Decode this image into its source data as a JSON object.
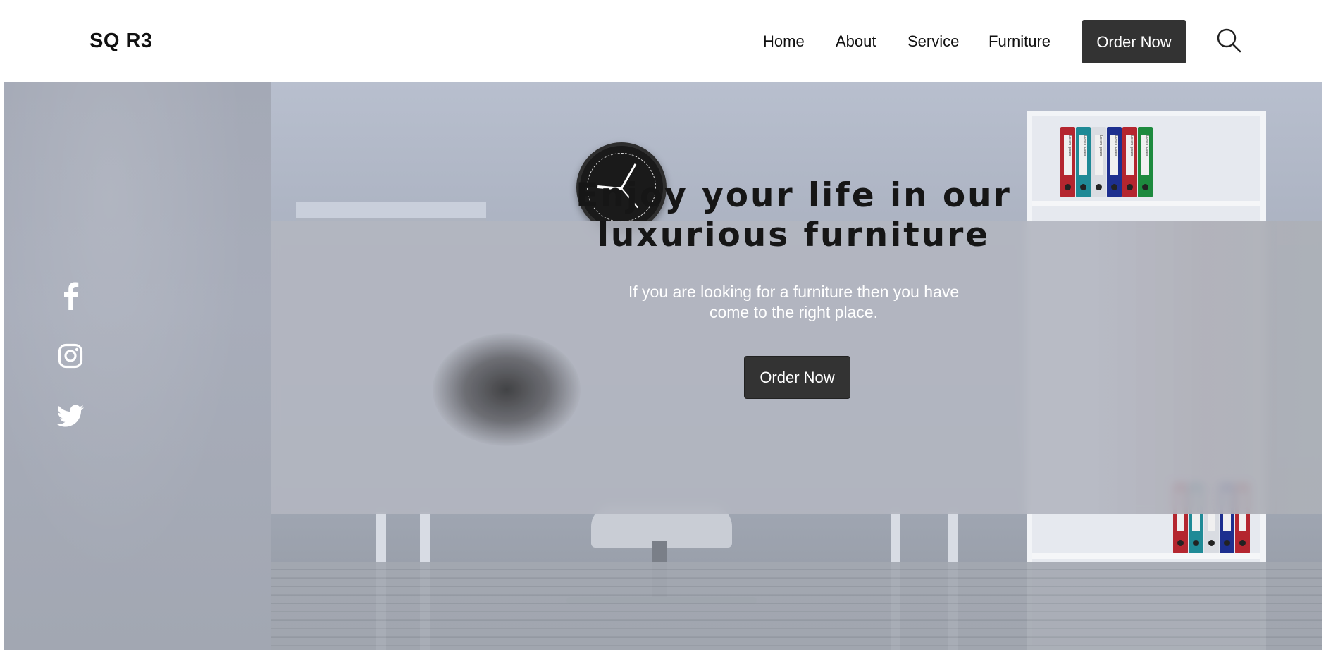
{
  "header": {
    "logo": "SQ R3",
    "nav": [
      {
        "label": "Home"
      },
      {
        "label": "About"
      },
      {
        "label": "Service"
      },
      {
        "label": "Furniture"
      }
    ],
    "order_button": "Order Now",
    "search_icon": "search-icon"
  },
  "social": [
    {
      "icon": "facebook-icon"
    },
    {
      "icon": "instagram-icon"
    },
    {
      "icon": "twitter-icon"
    }
  ],
  "hero": {
    "title_line1": "Enjoy your life in our",
    "title_line2": "luxurious furniture",
    "subtitle_line1": "If you are looking for a furniture then you have",
    "subtitle_line2": "come to the right place.",
    "order_button": "Order Now",
    "binder_label": "Lorem Ipsum"
  },
  "colors": {
    "button_bg": "#333333",
    "button_text": "#ffffff",
    "overlay": "#b2b6c0",
    "sidebar": "#a6abb8"
  }
}
